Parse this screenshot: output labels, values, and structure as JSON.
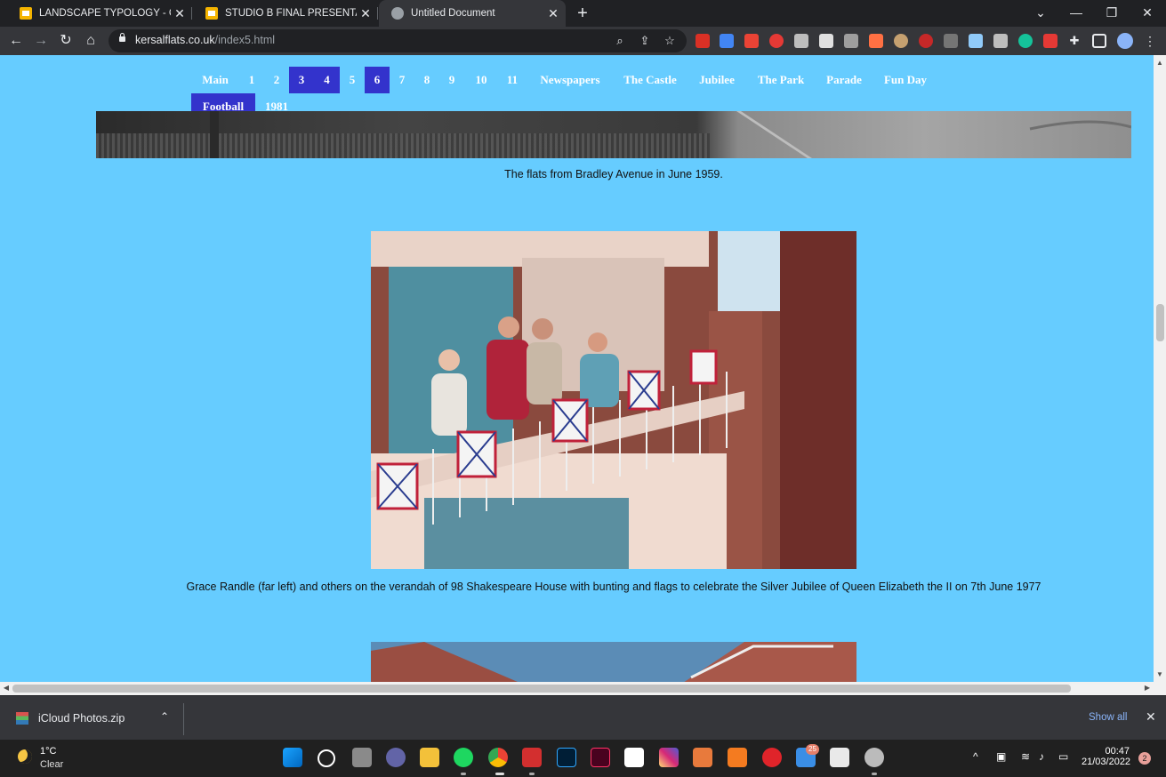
{
  "browser": {
    "tabs": [
      {
        "title": "LANDSCAPE TYPOLOGY - Google",
        "active": false
      },
      {
        "title": "STUDIO B FINAL PRESENTATION",
        "active": false
      },
      {
        "title": "Untitled Document",
        "active": true
      }
    ],
    "url": {
      "domain": "kersalflats.co.uk",
      "path": "/index5.html"
    },
    "icons": [
      "back-arrow-icon",
      "forward-arrow-icon",
      "reload-icon",
      "home-icon",
      "lock-icon",
      "zoom-icon",
      "share-icon",
      "bookmark-star-icon",
      "extensions-puzzle-icon",
      "profile-avatar-icon"
    ]
  },
  "site": {
    "background": "#66ccff",
    "nav": [
      {
        "label": "Main",
        "selected": false
      },
      {
        "label": "1",
        "selected": false
      },
      {
        "label": "2",
        "selected": false
      },
      {
        "label": "3",
        "selected": true
      },
      {
        "label": "4",
        "selected": true
      },
      {
        "label": "5",
        "selected": false
      },
      {
        "label": "6",
        "selected": true
      },
      {
        "label": "7",
        "selected": false
      },
      {
        "label": "8",
        "selected": false
      },
      {
        "label": "9",
        "selected": false
      },
      {
        "label": "10",
        "selected": false
      },
      {
        "label": "11",
        "selected": false
      },
      {
        "label": "Newspapers",
        "selected": false
      },
      {
        "label": "The Castle",
        "selected": false
      },
      {
        "label": "Jubilee",
        "selected": false
      },
      {
        "label": "The Park",
        "selected": false
      },
      {
        "label": "Parade",
        "selected": false
      },
      {
        "label": "Fun Day",
        "selected": false
      },
      {
        "label": "Football",
        "selected": true
      },
      {
        "label": "1981",
        "selected": false
      }
    ],
    "captions": {
      "photo1": "The flats from Bradley Avenue in June 1959.",
      "photo2": "Grace Randle (far left) and others on the verandah of 98 Shakespeare House with bunting and flags to celebrate the Silver Jubilee of Queen Elizabeth the II on 7th June 1977"
    }
  },
  "download": {
    "filename": "iCloud Photos.zip",
    "show_all": "Show all"
  },
  "taskbar": {
    "weather": {
      "temp": "1°C",
      "condition": "Clear"
    },
    "mail_badge": "25",
    "clock": {
      "time": "00:47",
      "date": "21/03/2022"
    },
    "notifications": "2"
  }
}
